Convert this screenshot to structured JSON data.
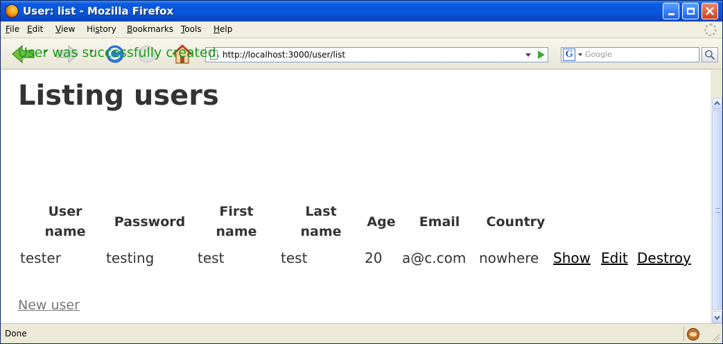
{
  "window": {
    "title": "User: list - Mozilla Firefox"
  },
  "menu": {
    "items": [
      {
        "accel": "F",
        "rest": "ile"
      },
      {
        "accel": "E",
        "rest": "dit"
      },
      {
        "accel": "V",
        "rest": "iew"
      },
      {
        "pre": "Hi",
        "accel": "s",
        "rest": "tory"
      },
      {
        "accel": "B",
        "rest": "ookmarks"
      },
      {
        "accel": "T",
        "rest": "ools"
      },
      {
        "accel": "H",
        "rest": "elp"
      }
    ]
  },
  "toolbar": {
    "url": "http://localhost:3000/user/list",
    "search_placeholder": "Google",
    "search_engine_letter": "G"
  },
  "page": {
    "notice": "User was successfully created.",
    "heading": "Listing users",
    "columns": [
      {
        "line1": "User",
        "line2": "name"
      },
      {
        "line1": "Password",
        "line2": ""
      },
      {
        "line1": "First",
        "line2": "name"
      },
      {
        "line1": "Last",
        "line2": "name"
      },
      {
        "line1": "Age",
        "line2": ""
      },
      {
        "line1": "Email",
        "line2": ""
      },
      {
        "line1": "Country",
        "line2": ""
      }
    ],
    "rows": [
      {
        "user_name": "tester",
        "password": "testing",
        "first_name": "test",
        "last_name": "test",
        "age": "20",
        "email": "a@c.com",
        "country": "nowhere",
        "show": "Show",
        "edit": "Edit",
        "destroy": "Destroy"
      }
    ],
    "new_user_link": "New user"
  },
  "status": {
    "text": "Done"
  },
  "colors": {
    "notice_green": "#1c9a1c",
    "heading_text": "#333333",
    "titlebar_blue": "#0a55d9"
  }
}
